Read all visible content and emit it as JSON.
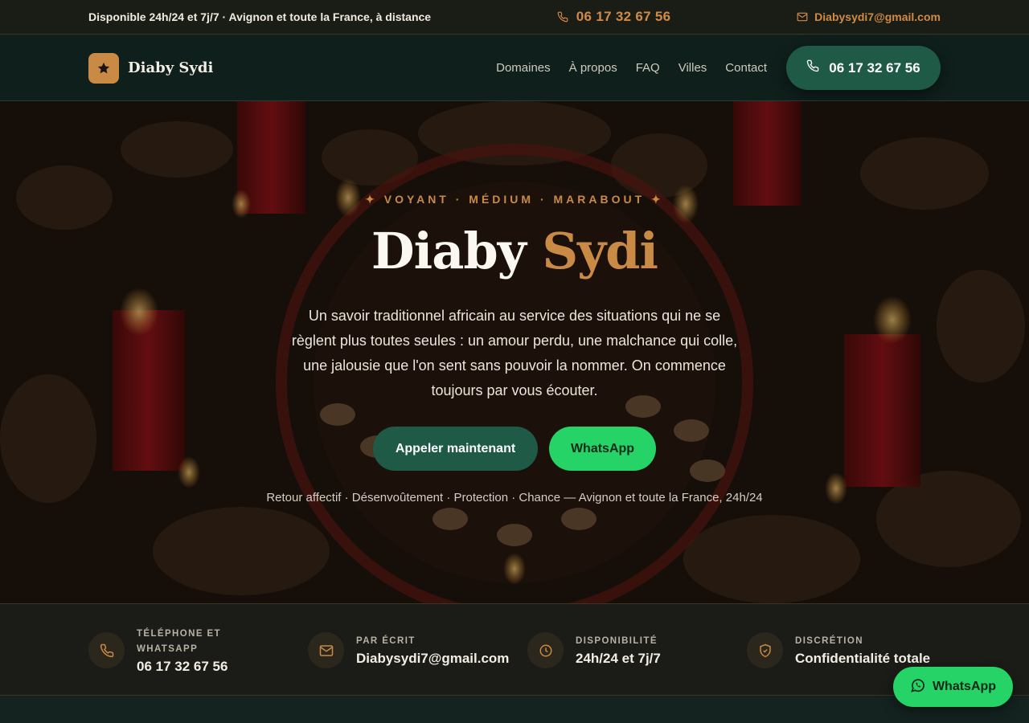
{
  "topbar": {
    "availability": "Disponible 24h/24 et 7j/7 · Avignon et toute la France, à distance",
    "phone": "06 17 32 67 56",
    "email": "Diabysydi7@gmail.com"
  },
  "nav": {
    "brand": "Diaby Sydi",
    "links": [
      "Domaines",
      "À propos",
      "FAQ",
      "Villes",
      "Contact"
    ],
    "call_label": "06 17 32 67 56"
  },
  "hero": {
    "eyebrow": "✦ VOYANT · MÉDIUM · MARABOUT ✦",
    "title_main": "Diaby",
    "title_accent": "Sydi",
    "lead": "Un savoir traditionnel africain au service des situations qui ne se règlent plus toutes seules : un amour perdu, une malchance qui colle, une jalousie que l'on sent sans pouvoir la nommer. On commence toujours par vous écouter.",
    "cta_call": "Appeler maintenant",
    "cta_whatsapp": "WhatsApp",
    "services": "Retour affectif · Désenvoûtement · Protection · Chance — Avignon et toute la France, 24h/24"
  },
  "info": [
    {
      "label": "TÉLÉPHONE ET WHATSAPP",
      "value": "06 17 32 67 56",
      "icon": "phone-icon"
    },
    {
      "label": "PAR ÉCRIT",
      "value": "Diabysydi7@gmail.com",
      "icon": "mail-icon"
    },
    {
      "label": "DISPONIBILITÉ",
      "value": "24h/24 et 7j/7",
      "icon": "clock-icon"
    },
    {
      "label": "DISCRÉTION",
      "value": "Confidentialité totale",
      "icon": "shield-icon"
    }
  ],
  "floating": {
    "whatsapp_label": "WhatsApp"
  },
  "colors": {
    "accent": "#c98a45",
    "green": "#1f5a47",
    "whatsapp": "#25d366"
  }
}
